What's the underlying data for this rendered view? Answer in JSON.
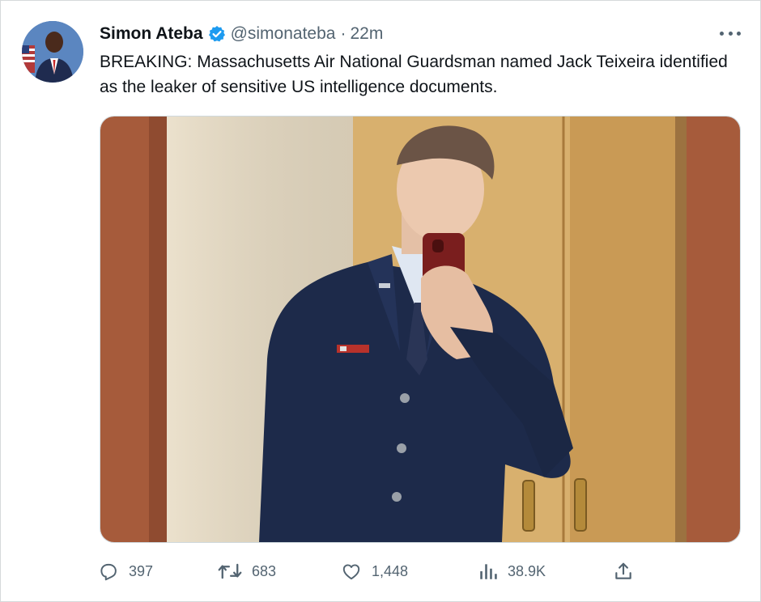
{
  "tweet": {
    "author_name": "Simon Ateba",
    "handle": "@simonateba",
    "separator": "·",
    "time": "22m",
    "text": "BREAKING: Massachusetts Air National Guardsman named Jack Teixeira identified as the leaker of sensitive US intelligence documents."
  },
  "icons": {
    "verified": "verified-badge-icon",
    "more": "more-horizontal-icon",
    "reply": "reply-icon",
    "retweet": "retweet-icon",
    "like": "heart-icon",
    "views": "views-chart-icon",
    "share": "share-icon"
  },
  "actions": {
    "replies": "397",
    "retweets": "683",
    "likes": "1,448",
    "views": "38.9K"
  },
  "colors": {
    "verified_blue": "#1d9bf0",
    "text_primary": "#0f1419",
    "text_secondary": "#536471",
    "uniform_blue": "#1d2a4a",
    "wood_panel": "#a0573a",
    "cabinet": "#d9b274"
  }
}
